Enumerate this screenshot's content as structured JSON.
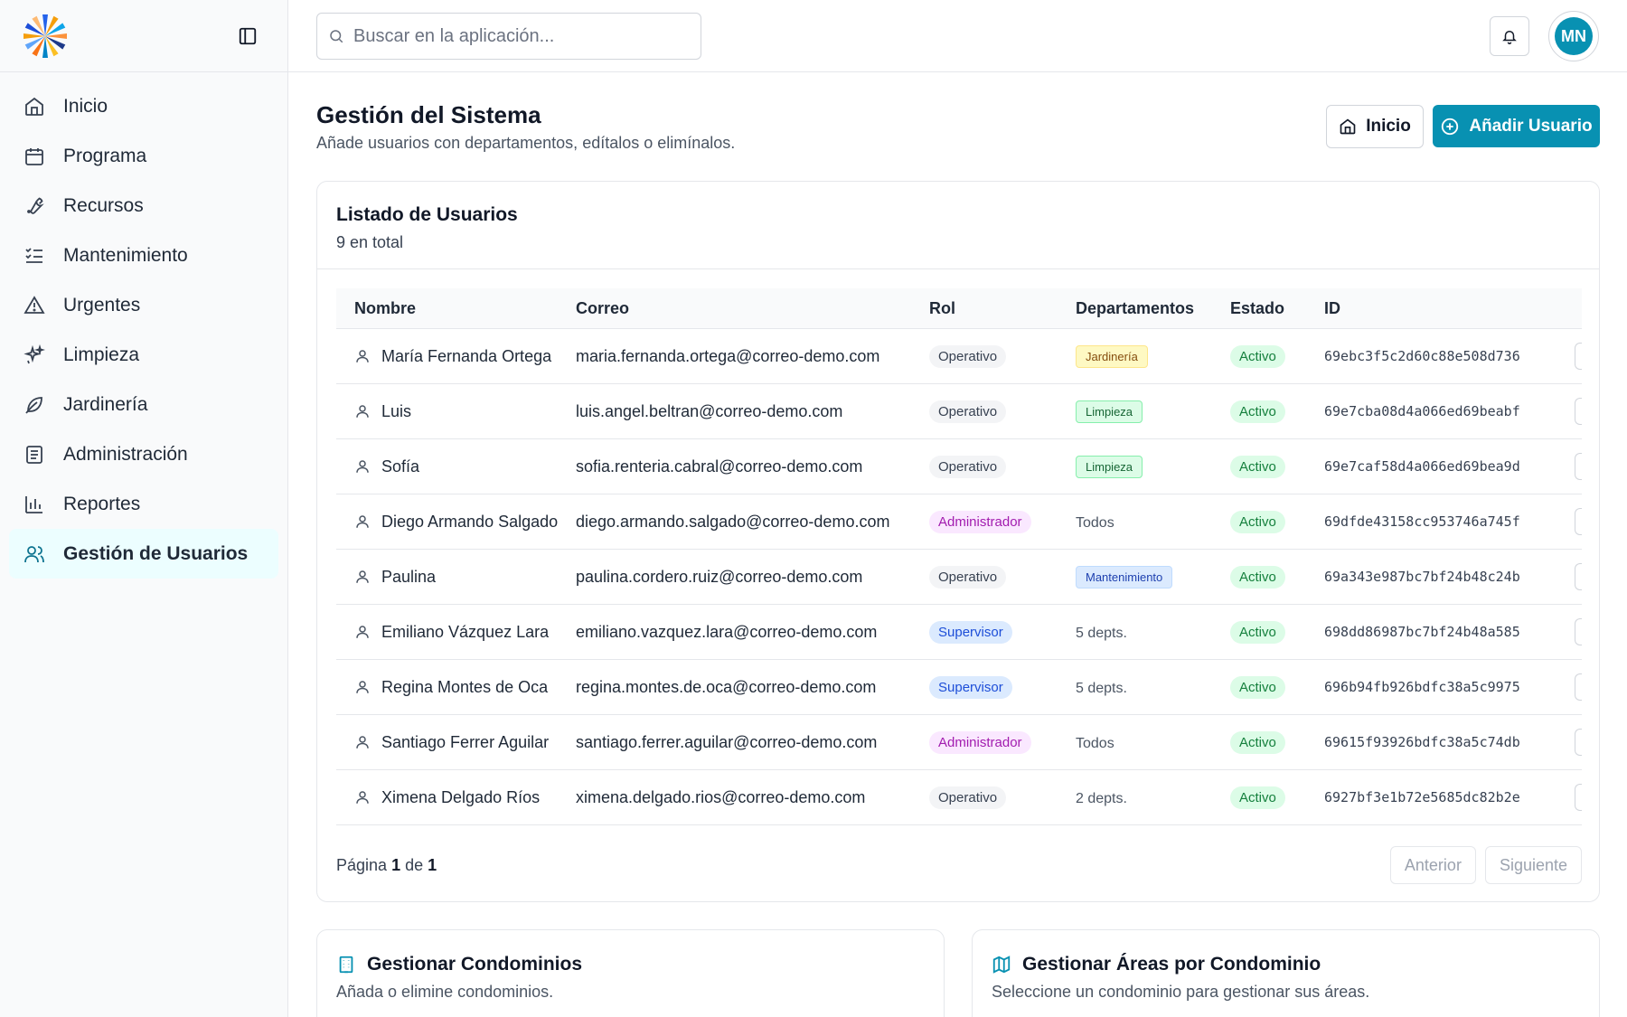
{
  "sidebar": {
    "items": [
      {
        "label": "Inicio",
        "icon": "home-icon"
      },
      {
        "label": "Programa",
        "icon": "calendar-icon"
      },
      {
        "label": "Recursos",
        "icon": "wrench-icon"
      },
      {
        "label": "Mantenimiento",
        "icon": "checklist-icon"
      },
      {
        "label": "Urgentes",
        "icon": "warning-icon"
      },
      {
        "label": "Limpieza",
        "icon": "sparkles-icon"
      },
      {
        "label": "Jardinería",
        "icon": "leaf-icon"
      },
      {
        "label": "Administración",
        "icon": "document-icon"
      },
      {
        "label": "Reportes",
        "icon": "bar-chart-icon"
      },
      {
        "label": "Gestión de Usuarios",
        "icon": "users-icon",
        "active": true
      }
    ]
  },
  "topbar": {
    "search_placeholder": "Buscar en la aplicación...",
    "avatar_initials": "MN"
  },
  "header": {
    "title": "Gestión del Sistema",
    "subtitle": "Añade usuarios con departamentos, edítalos o elimínalos.",
    "home_button": "Inicio",
    "add_button": "Añadir Usuario"
  },
  "users_card": {
    "title": "Listado de Usuarios",
    "count": "9 en total",
    "columns": [
      "Nombre",
      "Correo",
      "Rol",
      "Departamentos",
      "Estado",
      "ID"
    ],
    "rows": [
      {
        "name": "María Fernanda Ortega",
        "email": "maria.fernanda.ortega@correo-demo.com",
        "role": "Operativo",
        "dept": "Jardinería",
        "status": "Activo",
        "id": "69ebc3f5c2d60c88e508d736"
      },
      {
        "name": "Luis",
        "email": "luis.angel.beltran@correo-demo.com",
        "role": "Operativo",
        "dept": "Limpieza",
        "status": "Activo",
        "id": "69e7cba08d4a066ed69beabf"
      },
      {
        "name": "Sofía",
        "email": "sofia.renteria.cabral@correo-demo.com",
        "role": "Operativo",
        "dept": "Limpieza",
        "status": "Activo",
        "id": "69e7caf58d4a066ed69bea9d"
      },
      {
        "name": "Diego Armando Salgado",
        "email": "diego.armando.salgado@correo-demo.com",
        "role": "Administrador",
        "dept": "Todos",
        "status": "Activo",
        "id": "69dfde43158cc953746a745f"
      },
      {
        "name": "Paulina",
        "email": "paulina.cordero.ruiz@correo-demo.com",
        "role": "Operativo",
        "dept": "Mantenimiento",
        "status": "Activo",
        "id": "69a343e987bc7bf24b48c24b"
      },
      {
        "name": "Emiliano Vázquez Lara",
        "email": "emiliano.vazquez.lara@correo-demo.com",
        "role": "Supervisor",
        "dept": "5 depts.",
        "status": "Activo",
        "id": "698dd86987bc7bf24b48a585"
      },
      {
        "name": "Regina Montes de Oca",
        "email": "regina.montes.de.oca@correo-demo.com",
        "role": "Supervisor",
        "dept": "5 depts.",
        "status": "Activo",
        "id": "696b94fb926bdfc38a5c9975"
      },
      {
        "name": "Santiago Ferrer Aguilar",
        "email": "santiago.ferrer.aguilar@correo-demo.com",
        "role": "Administrador",
        "dept": "Todos",
        "status": "Activo",
        "id": "69615f93926bdfc38a5c74db"
      },
      {
        "name": "Ximena Delgado Ríos",
        "email": "ximena.delgado.rios@correo-demo.com",
        "role": "Operativo",
        "dept": "2 depts.",
        "status": "Activo",
        "id": "6927bf3e1b72e5685dc82b2e"
      }
    ],
    "pager": {
      "prefix": "Página",
      "current": "1",
      "of": "de",
      "total": "1",
      "prev": "Anterior",
      "next": "Siguiente"
    }
  },
  "condominios_card": {
    "title": "Gestionar Condominios",
    "subtitle": "Añada o elimine condominios."
  },
  "areas_card": {
    "title": "Gestionar Áreas por Condominio",
    "subtitle": "Seleccione un condominio para gestionar sus áreas."
  },
  "colors": {
    "accent": "#0891b2",
    "active_bg": "#ecfeff"
  }
}
